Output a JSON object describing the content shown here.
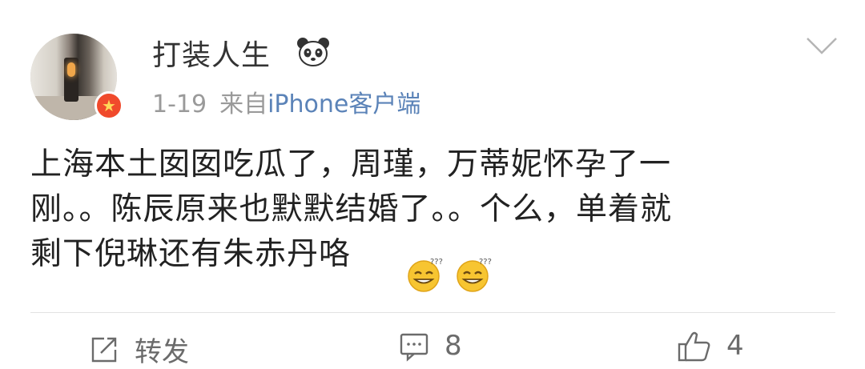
{
  "post": {
    "user": {
      "name": "打装人生",
      "avatar_icon": "avatar-photo",
      "verified_icon": "verified-star-badge-icon",
      "name_emoji_icon": "panda-icon"
    },
    "time": "1-19",
    "source_prefix": "来自",
    "source_client": "iPhone客户端",
    "text": "上海本土囡囡吃瓜了，周瑾，万蒂妮怀孕了一\n刚。。陈辰原来也默默结婚了。。个么，单着就\n剩下倪琳还有朱赤丹咯",
    "trailing_emojis": [
      "dizzy-grin-emoji-icon",
      "dizzy-grin-emoji-icon"
    ]
  },
  "actions": {
    "repost_label": "转发",
    "comment_count": "8",
    "like_count": "4"
  },
  "colors": {
    "text": "#222222",
    "meta": "#9a9a9a",
    "link": "#5b83b8",
    "divider": "#e2e2e2",
    "badge": "#f04a2c"
  }
}
